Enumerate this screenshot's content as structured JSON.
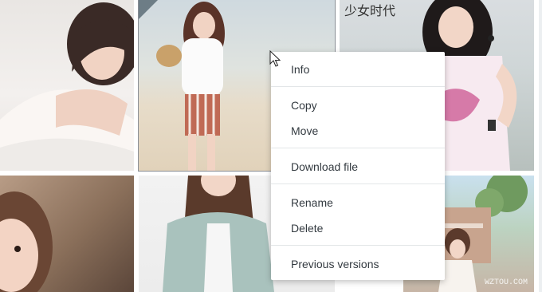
{
  "gallery": {
    "tiles": [
      {
        "subject": "woman-lying-photo"
      },
      {
        "subject": "woman-beach-photo",
        "selected": true
      },
      {
        "subject": "woman-pink-shirt-photo",
        "overlay_text": "少女时代"
      },
      {
        "subject": "woman-closeup-photo"
      },
      {
        "subject": "woman-blazer-photo"
      },
      {
        "subject": "woman-garden-photo",
        "watermark": "WZTOU.COM"
      }
    ]
  },
  "context_menu": {
    "groups": [
      [
        "Info"
      ],
      [
        "Copy",
        "Move"
      ],
      [
        "Download file"
      ],
      [
        "Rename",
        "Delete"
      ],
      [
        "Previous versions"
      ]
    ],
    "items": {
      "info": "Info",
      "copy": "Copy",
      "move": "Move",
      "download": "Download file",
      "rename": "Rename",
      "delete": "Delete",
      "previous_versions": "Previous versions"
    }
  },
  "colors": {
    "menu_bg": "#ffffff",
    "menu_text": "#333a40",
    "separator": "#e3e6e8",
    "selection_outline": "#8a8f96"
  },
  "icons": {
    "cursor": "arrow-cursor-icon"
  }
}
